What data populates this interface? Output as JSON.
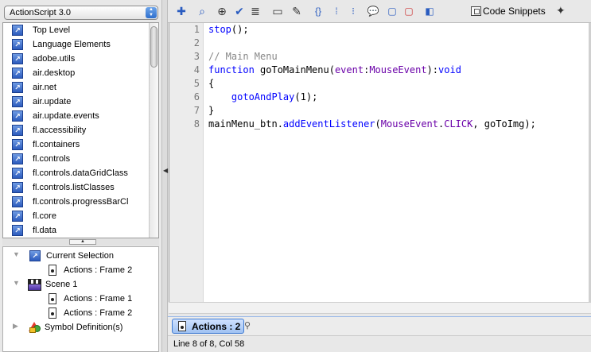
{
  "version_selector": {
    "value": "ActionScript 3.0"
  },
  "packages": [
    {
      "label": "Top Level"
    },
    {
      "label": "Language Elements"
    },
    {
      "label": "adobe.utils"
    },
    {
      "label": "air.desktop"
    },
    {
      "label": "air.net"
    },
    {
      "label": "air.update"
    },
    {
      "label": "air.update.events"
    },
    {
      "label": "fl.accessibility"
    },
    {
      "label": "fl.containers"
    },
    {
      "label": "fl.controls"
    },
    {
      "label": "fl.controls.dataGridClass"
    },
    {
      "label": "fl.controls.listClasses"
    },
    {
      "label": "fl.controls.progressBarCl"
    },
    {
      "label": "fl.core"
    },
    {
      "label": "fl.data"
    }
  ],
  "script_tree": {
    "current_selection": "Current Selection",
    "current_frame": "Actions : Frame 2",
    "scene": "Scene 1",
    "scene_frame_1": "Actions : Frame 1",
    "scene_frame_2": "Actions : Frame 2",
    "symbols": "Symbol Definition(s)"
  },
  "toolbar": {
    "code_snippets": "Code Snippets",
    "icons": [
      "add-statement-icon",
      "find-icon",
      "target-path-icon",
      "check-syntax-icon",
      "auto-format-icon",
      "code-hint-icon",
      "debug-options-icon",
      "collapse-between-braces-icon",
      "collapse-selection-icon",
      "expand-all-icon",
      "apply-block-comment-icon",
      "apply-line-comment-icon",
      "remove-comment-icon",
      "show-hide-toolbox-icon",
      "code-snippets-icon",
      "script-assist-icon"
    ]
  },
  "code": {
    "line_numbers": [
      "1",
      "2",
      "3",
      "4",
      "5",
      "6",
      "7",
      "8"
    ],
    "l1_fn": "stop",
    "l1_rest": "();",
    "l3_comment": "// Main Menu",
    "l4_kw": "function",
    "l4_name": " goToMainMenu(",
    "l4_param": "event",
    "l4_colon": ":",
    "l4_type": "MouseEvent",
    "l4_close": "):",
    "l4_ret": "void",
    "l5": "{",
    "l6_indent": "    ",
    "l6_fn": "gotoAndPlay",
    "l6_rest": "(1);",
    "l7": "}",
    "l8_obj": "mainMenu_btn.",
    "l8_fn": "addEventListener",
    "l8_open": "(",
    "l8_type": "MouseEvent",
    "l8_dot": ".",
    "l8_const": "CLICK",
    "l8_rest": ", goToImg);"
  },
  "tabs": {
    "active": "Actions : 2"
  },
  "status": {
    "text": "Line 8 of 8, Col 58"
  }
}
